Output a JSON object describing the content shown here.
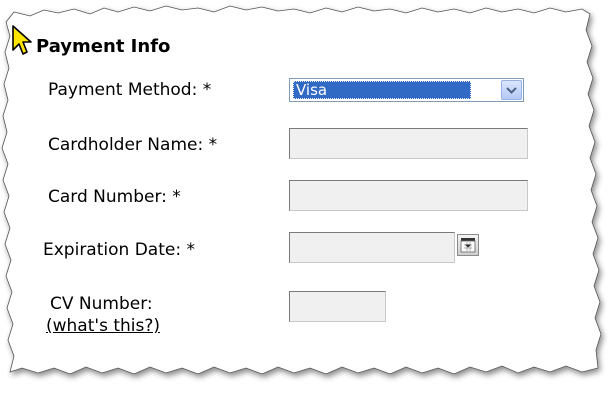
{
  "section": {
    "title": "Payment Info"
  },
  "fields": {
    "payment_method": {
      "label": "Payment Method: *",
      "value": "Visa"
    },
    "cardholder_name": {
      "label": "Cardholder Name: *",
      "value": ""
    },
    "card_number": {
      "label": "Card Number: *",
      "value": ""
    },
    "expiration_date": {
      "label": "Expiration Date: *",
      "value": ""
    },
    "cv_number": {
      "label": "CV Number:",
      "help_link": "(what's this?)",
      "value": ""
    }
  },
  "icons": {
    "cursor": "pointer-arrow-icon",
    "dropdown": "chevron-down-icon",
    "calendar": "calendar-icon"
  },
  "colors": {
    "selection": "#316ac5",
    "cursor_fill": "#ffe600",
    "input_bg": "#f0f0f0"
  }
}
